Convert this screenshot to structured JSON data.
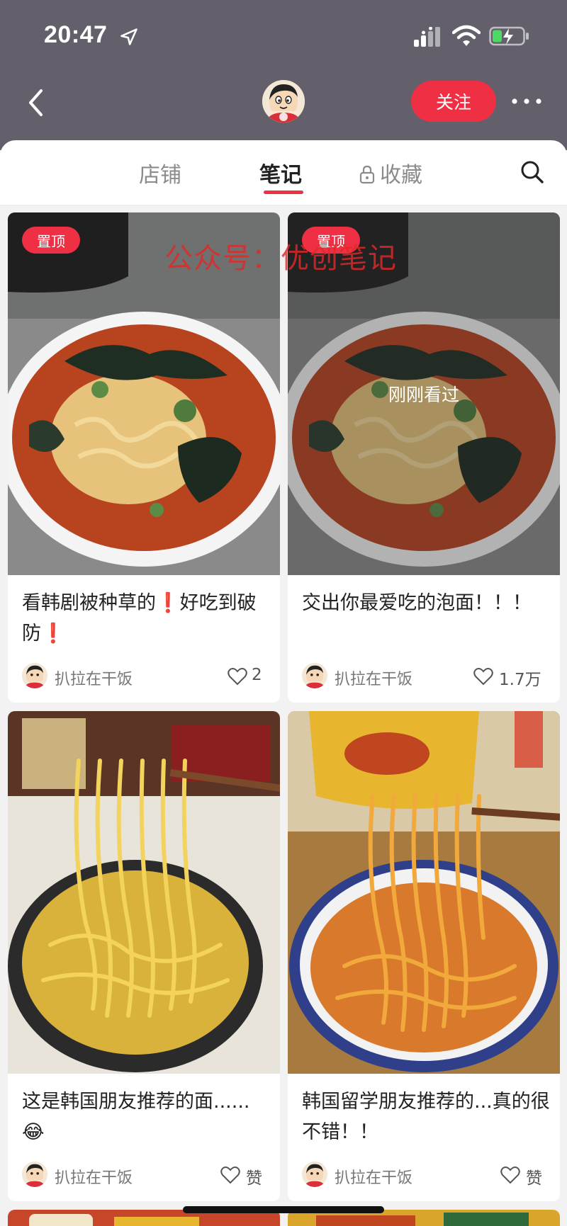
{
  "status_bar": {
    "time": "20:47",
    "icons": [
      "location-arrow-icon",
      "cellular-signal-icon",
      "wifi-icon",
      "battery-charging-icon"
    ]
  },
  "nav": {
    "back_icon": "chevron-left-icon",
    "follow_label": "关注",
    "more_icon": "ellipsis-icon"
  },
  "tabs": {
    "shop": "店铺",
    "notes": "笔记",
    "favorites": "收藏",
    "favorites_icon": "lock-icon",
    "search_icon": "search-icon",
    "active": "notes"
  },
  "watermark": "公众号：优创笔记",
  "colors": {
    "accent": "#ee2f44",
    "header_bg": "#63606b",
    "page_bg": "#f2f2f2"
  },
  "cards": [
    {
      "badge": "置顶",
      "title": "看韩剧被种草的❗好吃到破防❗",
      "author": "扒拉在干饭",
      "likes": "2",
      "cover": "ramen bowl with seaweed"
    },
    {
      "badge": "置顶",
      "overlay": "刚刚看过",
      "title": "交出你最爱吃的泡面！！！",
      "author": "扒拉在干饭",
      "likes": "1.7万",
      "cover": "ramen bowl with seaweed"
    },
    {
      "title": "这是韩国朋友推荐的面......😂",
      "author": "扒拉在干饭",
      "likes": "赞",
      "cover": "yellow noodles lifted with chopsticks"
    },
    {
      "title": "韩国留学朋友推荐的...真的很不错！！",
      "author": "扒拉在干饭",
      "likes": "赞",
      "cover": "spicy noodles lifted with chopsticks"
    }
  ]
}
